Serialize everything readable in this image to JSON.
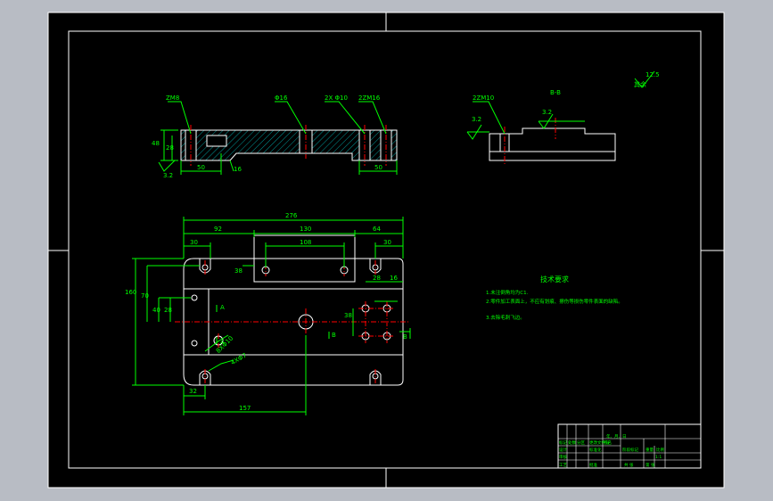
{
  "viewport": {
    "background": "#b8bcc4",
    "sheet_color": "#000000",
    "frame_color": "#ffffff"
  },
  "colors": {
    "outline": "#ffffff",
    "dimension": "#00ff00",
    "centerline": "#ff0000",
    "hatch": "#00ffff",
    "annotation": "#00ff00"
  },
  "section_view": {
    "labels": {
      "thread_left": "ZM8",
      "hole_mid": "Φ16",
      "thread_mid": "2X Φ10",
      "thread_right": "2ZM16"
    },
    "dims": {
      "height_total": "48",
      "height_step": "28",
      "width_left": "50",
      "width_right": "50",
      "small": "16",
      "roughness": "3.2"
    }
  },
  "view_bb": {
    "title": "B-B",
    "labels": {
      "thread": "2ZM10",
      "roughness_left": "3.2",
      "roughness_top": "3.2"
    }
  },
  "surface_note": {
    "text": "其余",
    "value": "12.5"
  },
  "plan_view": {
    "dims": {
      "overall_width": "276",
      "left_offset": "92",
      "mid_width": "130",
      "right_offset": "64",
      "slot_left": "30",
      "slot_right": "30",
      "inner_width": "108",
      "slot_depth": "38",
      "total_height": "160",
      "height_a": "70",
      "height_b": "40",
      "height_c": "28",
      "bottom_left": "32",
      "bottom_offset": "157",
      "right_small": "16",
      "right_a": "28",
      "right_b": "38",
      "hole_a": "8XΦ10",
      "hole_b": "4XΦ7"
    },
    "section_markers": {
      "a1": "A",
      "a2": "A",
      "b1": "B",
      "b2": "B"
    }
  },
  "technical_requirements": {
    "title": "技术要求",
    "items": [
      "1.未注倒角均为C1.",
      "2.零件加工表面上，不应有划痕、擦伤等损伤零件表面的缺陷。",
      "3.去除毛刺飞边。"
    ]
  },
  "title_block": {
    "rows": [
      [
        "标记",
        "处数",
        "分区",
        "更改文件号",
        "签名",
        "年、月、日"
      ],
      [
        "设计",
        "",
        "标准化",
        "",
        "阶段标记",
        "重量",
        "比例"
      ],
      [
        "审核",
        "",
        "",
        "",
        "",
        "",
        "1:1"
      ],
      [
        "工艺",
        "",
        "批准",
        "",
        "共 张",
        "第 张"
      ]
    ]
  }
}
